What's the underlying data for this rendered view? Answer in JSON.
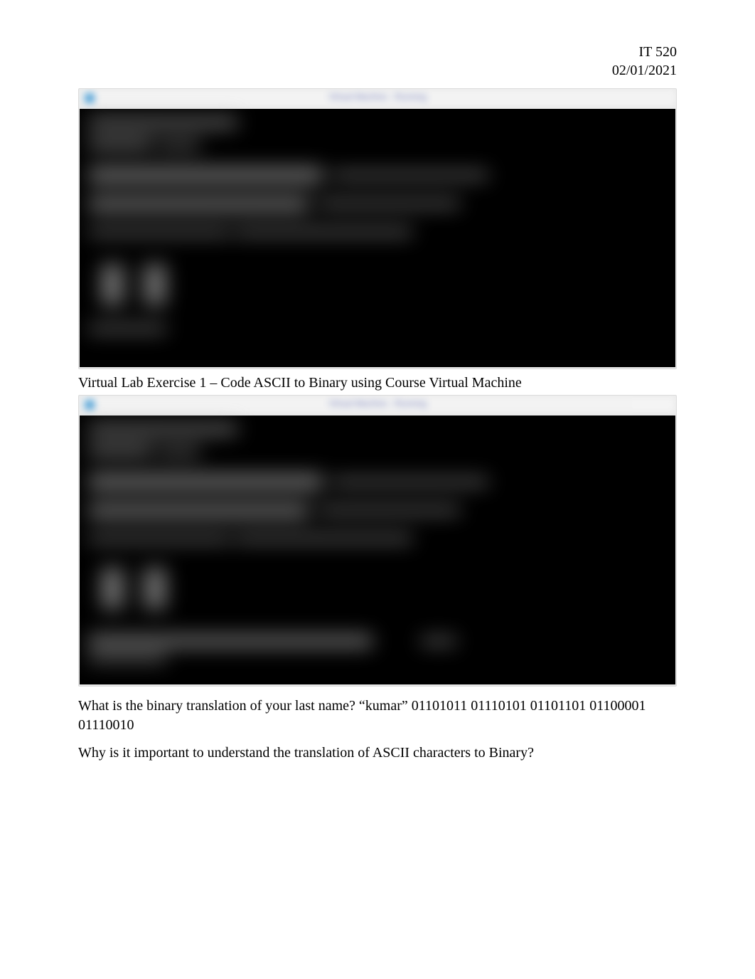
{
  "header": {
    "course": "IT 520",
    "date": "02/01/2021"
  },
  "titlebar": {
    "center_text": "Virtual Machine - Running"
  },
  "caption1": "Virtual Lab Exercise 1 – Code ASCII to Binary using Course Virtual Machine",
  "question1": "What is the binary translation of your last name? “kumar” 01101011 01110101 01101101 01100001 01110010",
  "question2": "Why is it important to understand the translation of ASCII characters to Binary?"
}
